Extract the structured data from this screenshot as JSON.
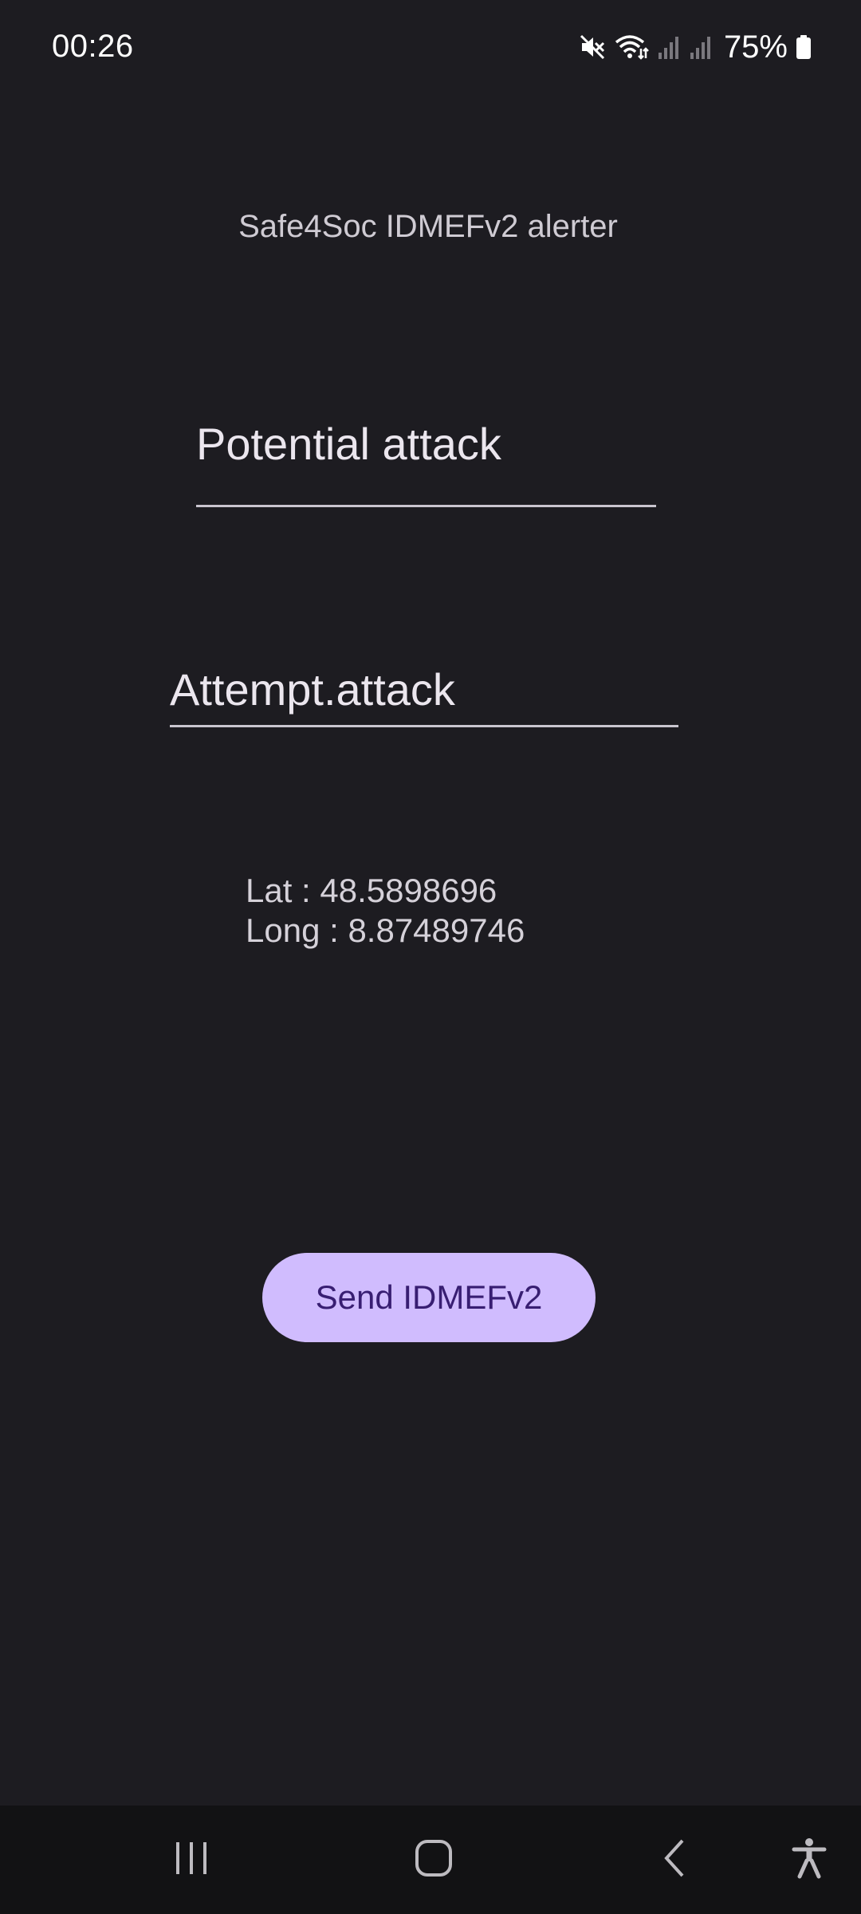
{
  "status_bar": {
    "time": "00:26",
    "battery_percent": "75%",
    "icons": [
      "mute-icon",
      "wifi-icon",
      "signal-icon-1",
      "signal-icon-2",
      "battery-icon"
    ]
  },
  "app": {
    "title": "Safe4Soc IDMEFv2 alerter"
  },
  "form": {
    "description_value": "Potential attack",
    "category_value": "Attempt.attack"
  },
  "location": {
    "lat_text": "Lat : 48.5898696",
    "long_text": "Long : 8.87489746"
  },
  "actions": {
    "send_label": "Send IDMEFv2"
  },
  "nav_bar": {
    "icons": [
      "recent-apps-icon",
      "home-icon",
      "back-icon",
      "accessibility-icon"
    ]
  },
  "colors": {
    "background": "#1d1c21",
    "button_background": "#d0bcfe",
    "button_text": "#381e72",
    "nav_background": "#121214"
  }
}
